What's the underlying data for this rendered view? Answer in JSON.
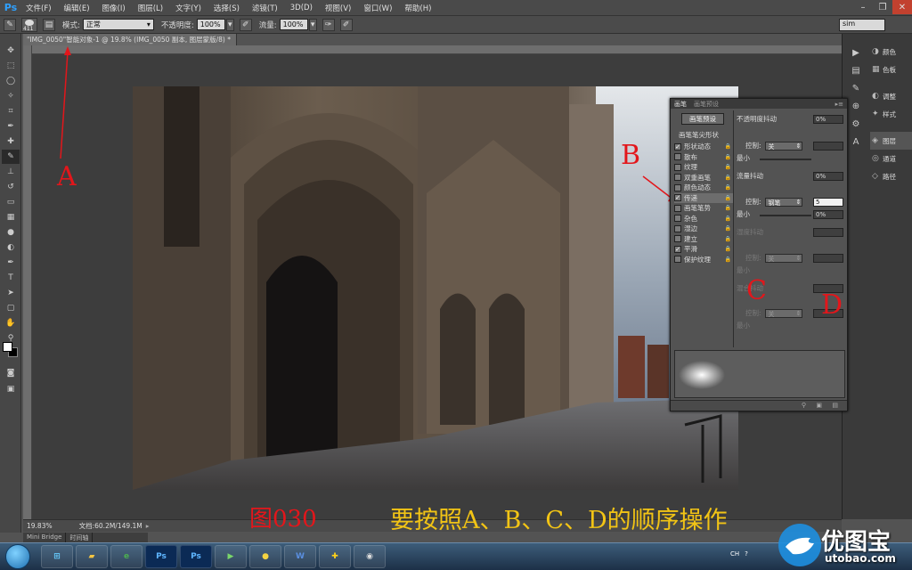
{
  "menubar": {
    "app_logo": "Ps",
    "items": [
      "文件(F)",
      "编辑(E)",
      "图像(I)",
      "图层(L)",
      "文字(Y)",
      "选择(S)",
      "滤镜(T)",
      "3D(D)",
      "视图(V)",
      "窗口(W)",
      "帮助(H)"
    ]
  },
  "options_bar": {
    "brush_size": "411",
    "mode_label": "模式:",
    "mode_value": "正常",
    "opacity_label": "不透明度:",
    "opacity_value": "100%",
    "flow_label": "流量:",
    "flow_value": "100%",
    "workspace_value": "sim"
  },
  "document": {
    "tab_title": "\"IMG_0050\"智能对象-1 @ 19.8% (IMG_0050 副本, 图层蒙版/8) *"
  },
  "right_panels": {
    "items": [
      {
        "icon": "palette-icon",
        "label": "颜色"
      },
      {
        "icon": "swatches-icon",
        "label": "色板"
      },
      {
        "icon": "adjustments-icon",
        "label": "调整"
      },
      {
        "icon": "styles-icon",
        "label": "样式"
      },
      {
        "icon": "layers-icon",
        "label": "图层"
      },
      {
        "icon": "channels-icon",
        "label": "通道"
      },
      {
        "icon": "paths-icon",
        "label": "路径"
      }
    ]
  },
  "brush_panel": {
    "tabs": [
      "画笔",
      "画笔预设"
    ],
    "presets_button": "画笔预设",
    "tip_shape": "画笔笔尖形状",
    "options": [
      {
        "label": "形状动态",
        "checked": true,
        "selected": false
      },
      {
        "label": "散布",
        "checked": false,
        "selected": false
      },
      {
        "label": "纹理",
        "checked": false,
        "selected": false
      },
      {
        "label": "双重画笔",
        "checked": false,
        "selected": false
      },
      {
        "label": "颜色动态",
        "checked": false,
        "selected": false
      },
      {
        "label": "传递",
        "checked": true,
        "selected": true
      },
      {
        "label": "画笔笔势",
        "checked": false,
        "selected": false
      },
      {
        "label": "杂色",
        "checked": false,
        "selected": false
      },
      {
        "label": "湿边",
        "checked": false,
        "selected": false
      },
      {
        "label": "建立",
        "checked": false,
        "selected": false
      },
      {
        "label": "平滑",
        "checked": true,
        "selected": false
      },
      {
        "label": "保护纹理",
        "checked": false,
        "selected": false
      }
    ],
    "opacity_jitter_label": "不透明度抖动",
    "opacity_jitter_value": "0%",
    "control_label": "控制:",
    "control1_value": "关",
    "min_label": "最小",
    "flow_jitter_label": "流量抖动",
    "flow_jitter_value": "0%",
    "control2_value": "钢笔",
    "control2_input": "5",
    "min2_value": "0%",
    "wet_jitter_label": "湿度抖动",
    "control3_value": "关",
    "mix_jitter_label": "混合抖动",
    "control4_value": "关"
  },
  "status": {
    "zoom": "19.83%",
    "doc_info": "文档:60.2M/149.1M",
    "bottom_tabs": [
      "Mini Bridge",
      "时间轴"
    ]
  },
  "annotations": {
    "a": "A",
    "b": "B",
    "c": "C",
    "d": "D",
    "fig": "图030",
    "instruction": "要按照A、B、C、D的顺序操作"
  },
  "taskbar": {
    "apps": [
      "explorer",
      "ie",
      "Ps",
      "Ps",
      "player",
      "qq",
      "W",
      "plus",
      "camera"
    ],
    "ps_label": "Ps",
    "word_label": "W",
    "lang": "CH"
  },
  "watermark": {
    "cn": "优图宝",
    "url": "utobao.com"
  },
  "colors": {
    "annotation_red": "#e3161b",
    "caption_yellow": "#f2c415",
    "ps_blue": "#2fa1ff"
  }
}
